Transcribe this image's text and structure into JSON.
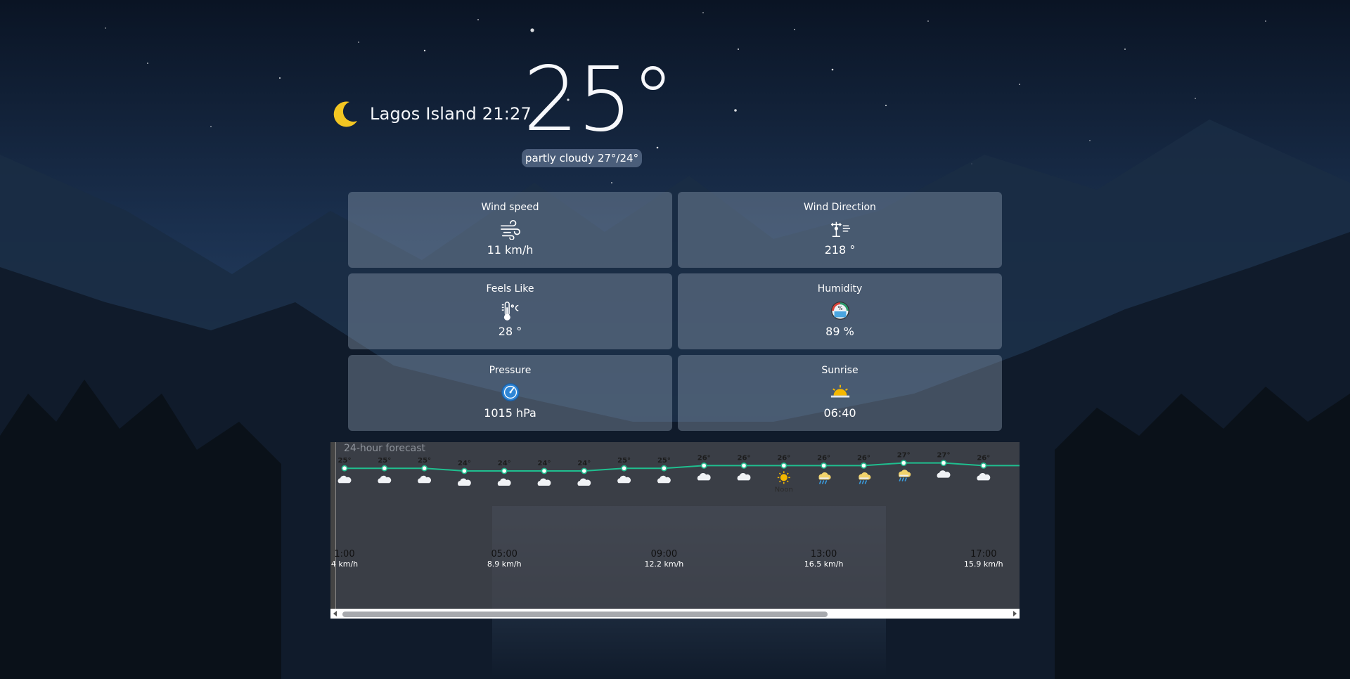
{
  "header": {
    "location_time": "Lagos Island 21:27",
    "temperature": "25°",
    "description": "partly cloudy 27°/24°"
  },
  "cards": [
    {
      "title": "Wind speed",
      "value": "11 km/h",
      "icon": "wind-icon"
    },
    {
      "title": "Wind Direction",
      "value": "218 °",
      "icon": "wind-vane-icon"
    },
    {
      "title": "Feels Like",
      "value": "28 °",
      "icon": "thermometer-icon"
    },
    {
      "title": "Humidity",
      "value": "89 %",
      "icon": "humidity-gauge-icon"
    },
    {
      "title": "Pressure",
      "value": "1015 hPa",
      "icon": "pressure-gauge-icon"
    },
    {
      "title": "Sunrise",
      "value": "06:40",
      "icon": "sunrise-icon"
    }
  ],
  "forecast": {
    "title": "24-hour forecast",
    "noon_label": "Noon",
    "colors": {
      "line": "#1fbf8f",
      "sun": "#f5b800",
      "rain": "#3a9ee0"
    },
    "chart_data": {
      "type": "line",
      "title": "24-hour forecast",
      "series": [
        {
          "values": [
            25,
            25,
            25,
            24,
            24,
            24,
            24,
            25,
            25,
            26,
            26,
            26,
            26,
            26,
            27,
            27,
            26
          ]
        }
      ],
      "temp_labels": [
        "25°",
        "25°",
        "25°",
        "24°",
        "24°",
        "24°",
        "24°",
        "25°",
        "25°",
        "26°",
        "26°",
        "26°",
        "26°",
        "26°",
        "27°",
        "27°",
        "26°"
      ],
      "conditions": [
        "cloud",
        "cloud",
        "cloud",
        "cloud",
        "cloud",
        "cloud",
        "cloud",
        "cloud",
        "cloud",
        "cloud",
        "cloud",
        "sun",
        "rain",
        "rain",
        "rain",
        "cloud",
        "cloud"
      ],
      "time_labels": [
        "1:00",
        "05:00",
        "09:00",
        "13:00",
        "17:00"
      ],
      "wind_labels": [
        "4 km/h",
        "8.9 km/h",
        "12.2 km/h",
        "16.5 km/h",
        "15.9 km/h"
      ]
    }
  }
}
